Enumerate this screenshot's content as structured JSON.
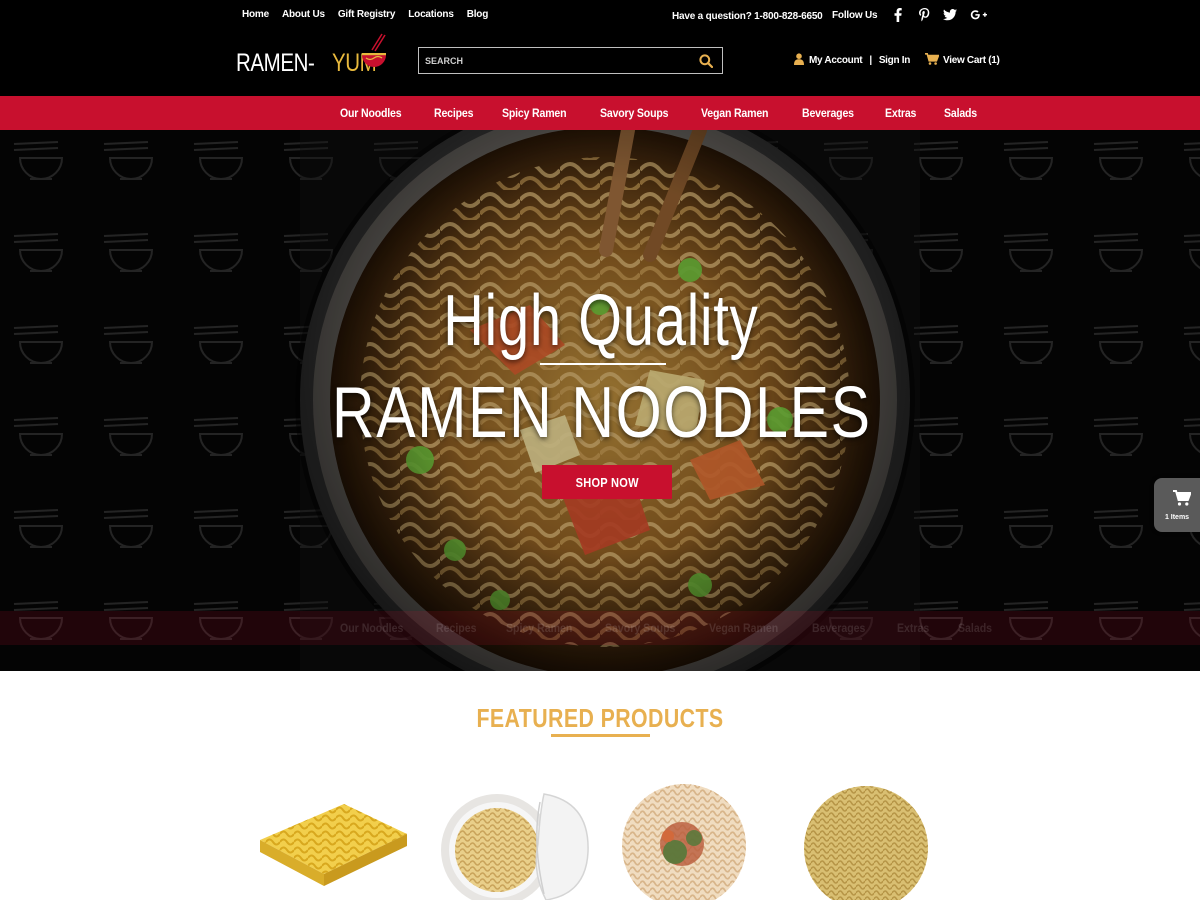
{
  "topbar": {
    "links": [
      "Home",
      "About Us",
      "Gift Registry",
      "Locations",
      "Blog"
    ],
    "question": "Have a question? 1-800-828-6650",
    "follow_label": "Follow Us",
    "social_icons": [
      "facebook-icon",
      "pinterest-icon",
      "twitter-icon",
      "google-plus-icon"
    ]
  },
  "logo": {
    "part1": "RAMEN-",
    "part2": "YUM"
  },
  "search": {
    "placeholder": "SEARCH",
    "value": ""
  },
  "account": {
    "my_account": "My Account",
    "separator": "|",
    "sign_in": "Sign In",
    "view_cart": "View Cart (1)"
  },
  "nav": {
    "items": [
      "Our Noodles",
      "Recipes",
      "Spicy Ramen",
      "Savory Soups",
      "Vegan Ramen",
      "Beverages",
      "Extras",
      "Salads"
    ]
  },
  "hero": {
    "title_line1": "High Quality",
    "title_line2": "RAMEN NOODLES",
    "cta": "SHOP NOW"
  },
  "floating_cart": {
    "label": "1 Items"
  },
  "featured": {
    "title": "FEATURED PRODUCTS",
    "products": [
      "noodle-block",
      "noodle-cup",
      "noodle-with-seasoning",
      "round-noodle-cake"
    ]
  },
  "colors": {
    "brand_red": "#c8102e",
    "brand_gold": "#e8b050",
    "header_bg": "#000000"
  }
}
